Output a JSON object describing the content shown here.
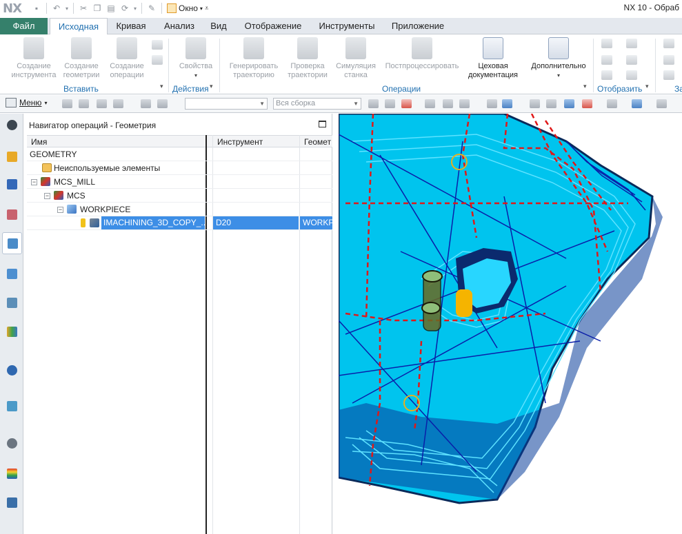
{
  "app": {
    "logo": "NX",
    "window_menu": "Окно",
    "title": "NX 10 - Обраб"
  },
  "tabs": [
    {
      "label": "Файл"
    },
    {
      "label": "Исходная"
    },
    {
      "label": "Кривая"
    },
    {
      "label": "Анализ"
    },
    {
      "label": "Вид"
    },
    {
      "label": "Отображение"
    },
    {
      "label": "Инструменты"
    },
    {
      "label": "Приложение"
    }
  ],
  "ribbon": {
    "insert": {
      "label": "Вставить",
      "create_tool": "Создание\nинструмента",
      "create_geometry": "Создание\nгеометрии",
      "create_operation": "Создание\nоперации"
    },
    "actions": {
      "label": "Действия",
      "properties": "Свойства"
    },
    "operations": {
      "label": "Операции",
      "generate_path": "Генерировать\nтраекторию",
      "verify_path": "Проверка\nтраектории",
      "simulate_machine": "Симуляция\nстанка",
      "postprocess": "Постпроцессировать",
      "shop_docs": "Цеховая\nдокументация",
      "more": "Дополнительно"
    },
    "display": {
      "label": "Отобразить"
    },
    "cut_label": "За"
  },
  "toolbar": {
    "menu_label": "Меню",
    "filter_value": "",
    "assembly_value": "Вся сборка"
  },
  "navigator": {
    "title": "Навигатор операций - Геометрия",
    "columns": [
      "Имя",
      "Инструмент",
      "Геомет"
    ],
    "rows": [
      {
        "name": "GEOMETRY",
        "tool": "",
        "geom": ""
      },
      {
        "name": "Неиспользуемые элементы",
        "tool": "",
        "geom": ""
      },
      {
        "name": "MCS_MILL",
        "tool": "",
        "geom": ""
      },
      {
        "name": "MCS",
        "tool": "",
        "geom": ""
      },
      {
        "name": "WORKPIECE",
        "tool": "",
        "geom": ""
      },
      {
        "name": "IMACHINING_3D_COPY_...",
        "tool": "D20",
        "geom": "WORKP"
      }
    ]
  },
  "colors": {
    "file_tab": "#35806b",
    "accent_blue": "#2170b0",
    "selection": "#3d8ee6",
    "part_cyan": "#00c8f0",
    "toolpath_blue": "#1020c0",
    "rapid_red": "#e01818"
  }
}
